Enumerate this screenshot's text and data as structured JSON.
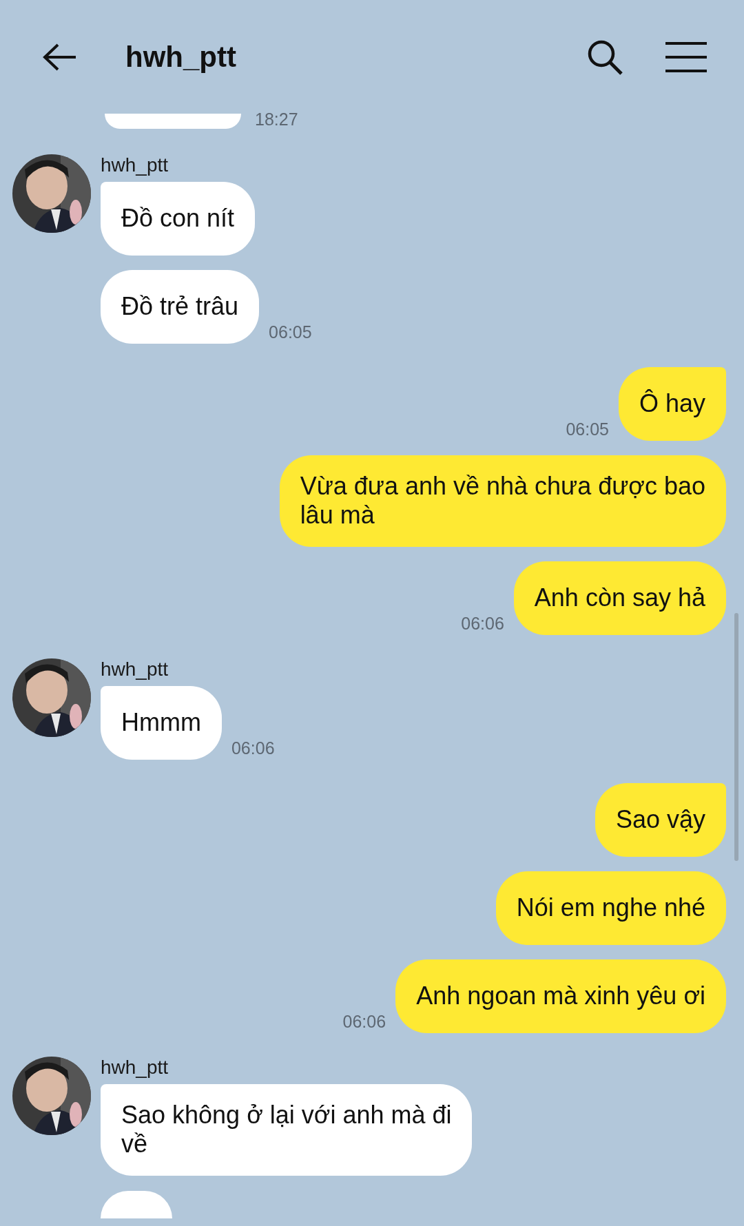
{
  "header": {
    "title": "hwh_ptt"
  },
  "top_fragment": {
    "kind": "incoming",
    "time": "18:27"
  },
  "messages": [
    {
      "kind": "incoming",
      "sender": "hwh_ptt",
      "lines": [
        "Đồ con nít"
      ]
    },
    {
      "kind": "incoming",
      "lines": [
        "Đồ trẻ trâu"
      ],
      "time": "06:05"
    },
    {
      "kind": "outgoing",
      "lines": [
        "Ô hay"
      ],
      "time": "06:05"
    },
    {
      "kind": "outgoing",
      "lines": [
        "Vừa đưa anh về nhà chưa được bao",
        "lâu mà"
      ]
    },
    {
      "kind": "outgoing",
      "lines": [
        "Anh còn say hả"
      ],
      "time": "06:06"
    },
    {
      "kind": "incoming",
      "sender": "hwh_ptt",
      "lines": [
        "Hmmm"
      ],
      "time": "06:06"
    },
    {
      "kind": "outgoing",
      "lines": [
        "Sao vậy"
      ]
    },
    {
      "kind": "outgoing",
      "lines": [
        "Nói em nghe nhé"
      ]
    },
    {
      "kind": "outgoing",
      "lines": [
        "Anh ngoan mà xinh yêu ơi"
      ],
      "time": "06:06"
    },
    {
      "kind": "incoming",
      "sender": "hwh_ptt",
      "lines": [
        "Sao không ở lại với anh mà đi",
        "về"
      ]
    }
  ],
  "bottom_fragment": {
    "kind": "incoming"
  }
}
